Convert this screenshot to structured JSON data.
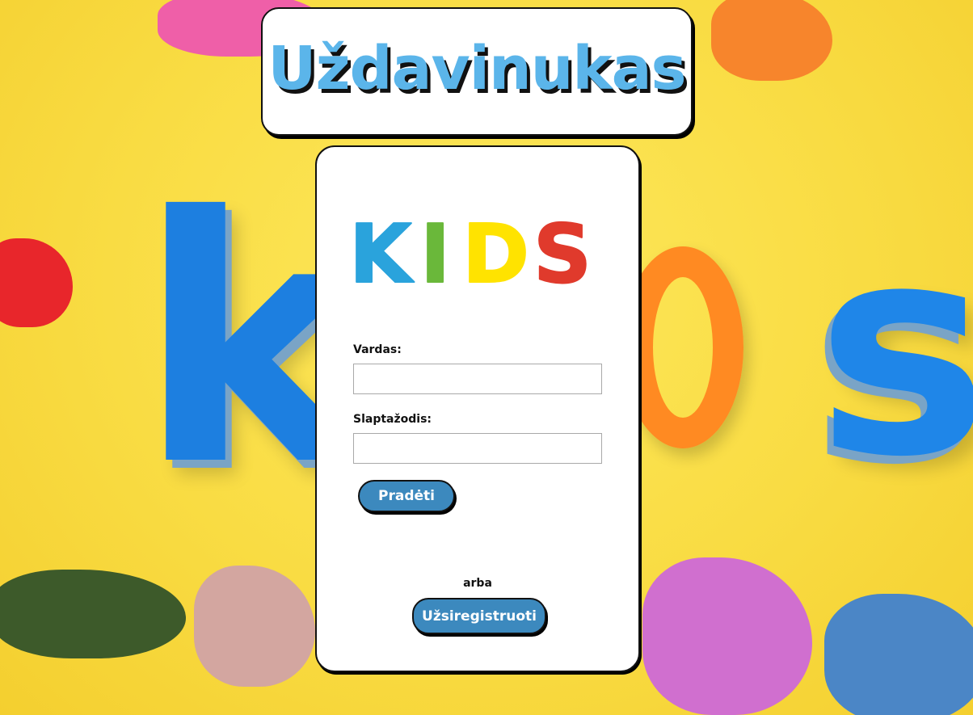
{
  "header": {
    "title": "Uždavinukas"
  },
  "logo": {
    "letters": [
      {
        "char": "K",
        "color": "#2aa3dc"
      },
      {
        "char": "I",
        "color": "#6ab83a"
      },
      {
        "char": "D",
        "color": "#ffe300"
      },
      {
        "char": "S",
        "color": "#e03a2c"
      }
    ]
  },
  "login": {
    "username_label": "Vardas:",
    "username_value": "",
    "password_label": "Slaptažodis:",
    "password_value": "",
    "start_button": "Pradėti",
    "or_text": "arba",
    "register_button": "Užsiregistruoti"
  },
  "colors": {
    "background": "#fbe04d",
    "button": "#3c89be",
    "title": "#5bb5ea"
  }
}
